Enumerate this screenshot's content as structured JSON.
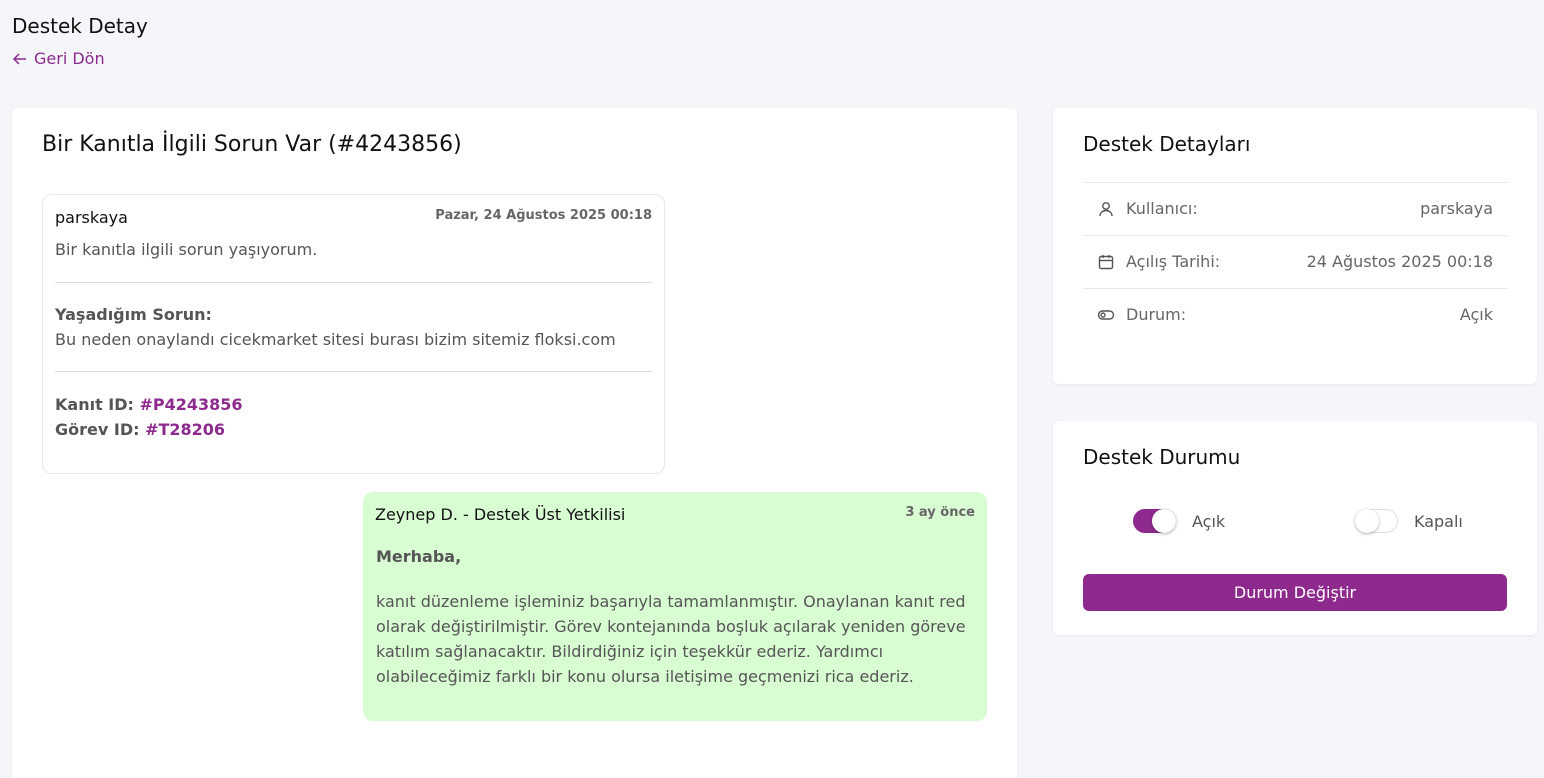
{
  "header": {
    "title": "Destek Detay",
    "back_label": "Geri Dön"
  },
  "ticket": {
    "title": "Bir Kanıtla İlgili Sorun Var (#4243856)",
    "user_message": {
      "author": "parskaya",
      "date": "Pazar, 24 Ağustos 2025 00:18",
      "text": "Bir kanıtla ilgili sorun yaşıyorum.",
      "issue_label": "Yaşadığım Sorun:",
      "issue_text": "Bu neden onaylandı cicekmarket sitesi burası bizim sitemiz floksi.com",
      "proof_label": "Kanıt ID:",
      "proof_id": "#P4243856",
      "task_label": "Görev ID:",
      "task_id": "#T28206"
    },
    "admin_message": {
      "author": "Zeynep D. - Destek Üst Yetkilisi",
      "time": "3 ay önce",
      "greeting": "Merhaba,",
      "body": "kanıt düzenleme işleminiz başarıyla tamamlanmıştır. Onaylanan kanıt red olarak değiştirilmiştir. Görev kontejanında boşluk açılarak yeniden göreve katılım sağlanacaktır. Bildirdiğiniz için teşekkür ederiz. Yardımcı olabileceğimiz farklı bir konu olursa iletişime geçmenizi rica ederiz."
    }
  },
  "details": {
    "title": "Destek Detayları",
    "rows": [
      {
        "icon": "user-icon",
        "label": "Kullanıcı:",
        "value": "parskaya"
      },
      {
        "icon": "calendar-icon",
        "label": "Açılış Tarihi:",
        "value": "24 Ağustos 2025 00:18"
      },
      {
        "icon": "toggle-icon",
        "label": "Durum:",
        "value": "Açık"
      }
    ]
  },
  "status": {
    "title": "Destek Durumu",
    "open_label": "Açık",
    "open_checked": true,
    "closed_label": "Kapalı",
    "closed_checked": false,
    "button_label": "Durum Değiştir"
  },
  "colors": {
    "accent": "#8e2a8e",
    "admin_bubble": "#d9fdd3",
    "background": "#f5f6fa"
  }
}
